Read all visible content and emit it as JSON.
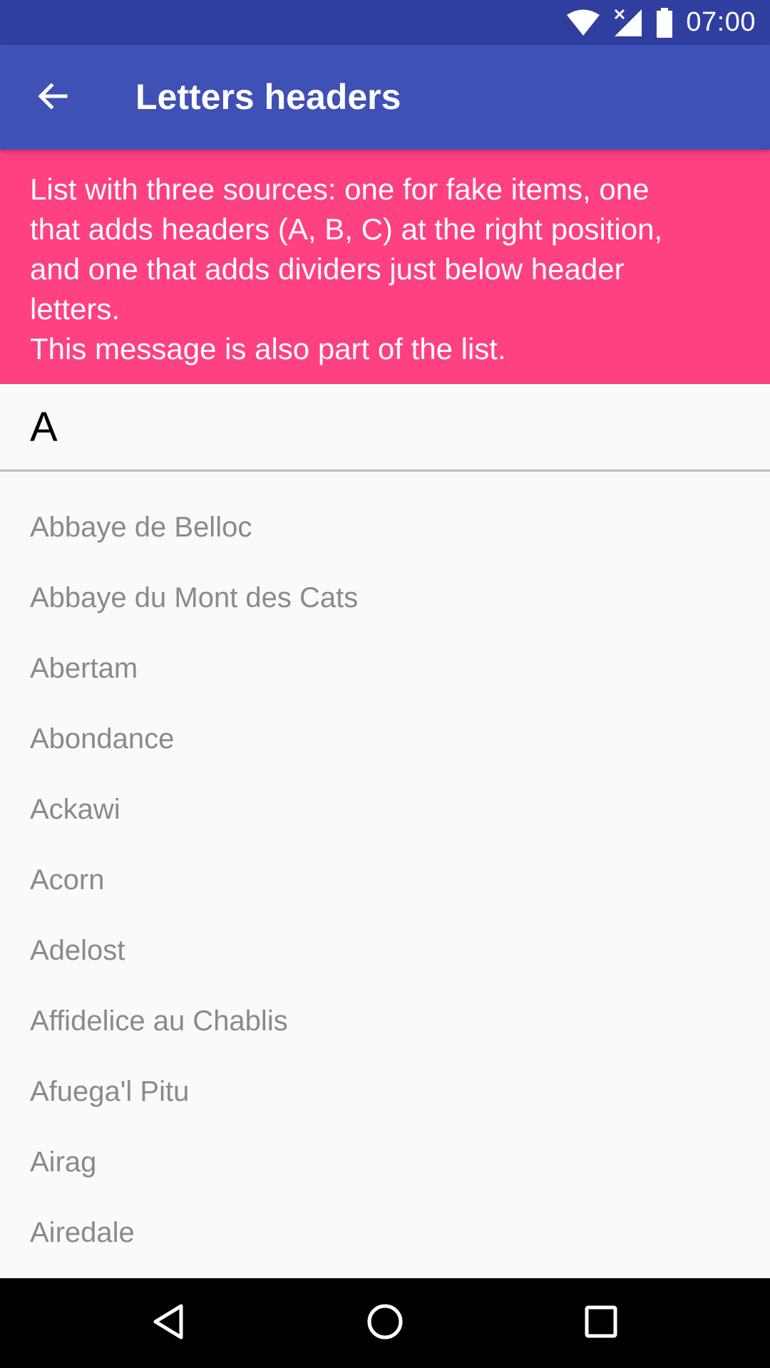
{
  "status_bar": {
    "time": "07:00",
    "icons": [
      "wifi-icon",
      "signal-icon",
      "battery-icon"
    ],
    "color": "#303f9f"
  },
  "app_bar": {
    "title": "Letters headers",
    "back_icon": "arrow-back-icon",
    "color": "#3f51b5"
  },
  "banner": {
    "lines": [
      "List with three sources: one for fake items, one",
      "that adds headers (A, B, C) at the right position,",
      "and one that adds dividers just below header",
      "letters.",
      "This message is also part of the list."
    ],
    "color": "#ff4081"
  },
  "section": {
    "header": "A",
    "items": [
      "Abbaye de Belloc",
      "Abbaye du Mont des Cats",
      "Abertam",
      "Abondance",
      "Ackawi",
      "Acorn",
      "Adelost",
      "Affidelice au Chablis",
      "Afuega'l Pitu",
      "Airag",
      "Airedale"
    ]
  },
  "nav_bar": {
    "buttons": [
      "back-triangle-icon",
      "home-circle-icon",
      "recents-square-icon"
    ]
  }
}
